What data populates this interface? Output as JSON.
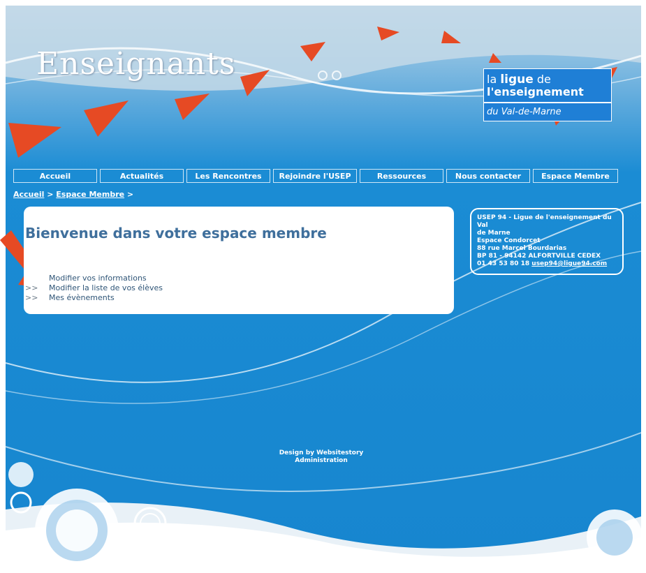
{
  "site": {
    "title": "Enseignants",
    "logo": {
      "line1_a": "la ",
      "line1_b": "ligue",
      "line1_c": " de",
      "line2": "l'enseignement",
      "line3": "du Val-de-Marne"
    }
  },
  "nav": {
    "items": [
      {
        "label": "Accueil"
      },
      {
        "label": "Actualités"
      },
      {
        "label": "Les Rencontres"
      },
      {
        "label": "Rejoindre l'USEP"
      },
      {
        "label": "Ressources"
      },
      {
        "label": "Nous contacter"
      },
      {
        "label": "Espace Membre"
      }
    ]
  },
  "breadcrumb": {
    "home": "Accueil",
    "sep1": " > ",
    "current": "Espace Membre",
    "sep2": " >"
  },
  "main": {
    "welcome": "Bienvenue dans votre espace membre",
    "prefix": ">>",
    "links": [
      {
        "label": "Modifier vos informations"
      },
      {
        "label": "Modifier la liste de vos élèves"
      },
      {
        "label": "Mes évènements"
      }
    ]
  },
  "contact": {
    "line1": "USEP 94 - Ligue de l'enseignement du Val",
    "line2": "de Marne",
    "line3": "Espace Condorcet",
    "line4": "88 rue Marcel Bourdarias",
    "line5": "BP 81 - 94142 ALFORTVILLE CEDEX",
    "phone": "01 43 53 80 18",
    "email": "usep94@ligue94.com"
  },
  "footer": {
    "design": "Design by Websitestory",
    "admin": "Administration"
  },
  "colors": {
    "background_blue": "#1a8fd6",
    "accent_red": "#e64a24",
    "title_blue": "#3f6f9c"
  }
}
